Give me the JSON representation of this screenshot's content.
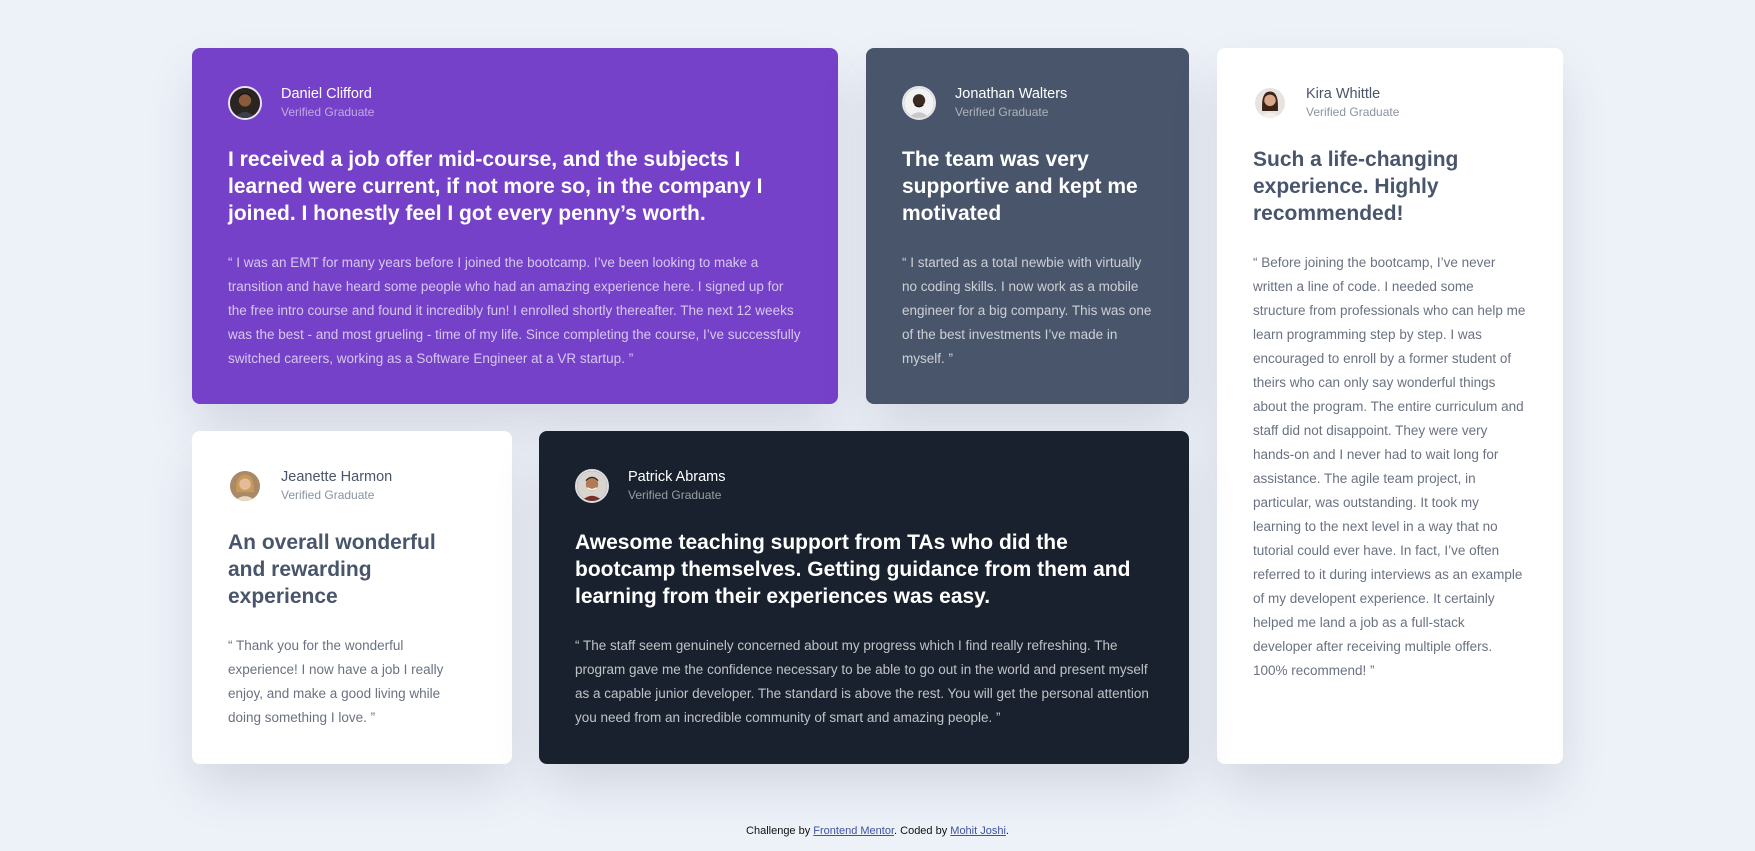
{
  "testimonials": [
    {
      "name": "Daniel Clifford",
      "role": "Verified Graduate",
      "avatar_icon": "avatar-daniel",
      "headline": "I received a job offer mid-course, and the subjects I learned were current, if not more so, in the company I joined. I honestly feel I got every penny’s worth.",
      "quote": "“ I was an EMT for many years before I joined the bootcamp. I’ve been looking to make a transition and have heard some people who had an amazing experience here. I signed up for the free intro course and found it incredibly fun! I enrolled shortly thereafter. The next 12 weeks was the best - and most grueling - time of my life. Since completing the course, I’ve successfully switched careers, working as a Software Engineer at a VR startup. ”"
    },
    {
      "name": "Jonathan Walters",
      "role": "Verified Graduate",
      "avatar_icon": "avatar-jonathan",
      "headline": "The team was very supportive and kept me motivated",
      "quote": "“ I started as a total newbie with virtually no coding skills. I now work as a mobile engineer for a big company. This was one of the best investments I’ve made in myself. ”"
    },
    {
      "name": "Kira Whittle",
      "role": "Verified Graduate",
      "avatar_icon": "avatar-kira",
      "headline": "Such a life-changing experience. Highly recommended!",
      "quote": "“ Before joining the bootcamp, I’ve never written a line of code. I needed some structure from professionals who can help me learn programming step by step. I was encouraged to enroll by a former student of theirs who can only say wonderful things about the program. The entire curriculum and staff did not disappoint. They were very hands-on and I never had to wait long for assistance. The agile team project, in particular, was outstanding. It took my learning to the next level in a way that no tutorial could ever have. In fact, I’ve often referred to it during interviews as an example of my developent experience. It certainly helped me land a job as a full-stack developer after receiving multiple offers. 100% recommend! ”"
    },
    {
      "name": "Jeanette Harmon",
      "role": "Verified Graduate",
      "avatar_icon": "avatar-jeanette",
      "headline": "An overall wonderful and rewarding experience",
      "quote": "“ Thank you for the wonderful experience! I now have a job I really enjoy, and make a good living while doing something I love. ”"
    },
    {
      "name": "Patrick Abrams",
      "role": "Verified Graduate",
      "avatar_icon": "avatar-patrick",
      "headline": "Awesome teaching support from TAs who did the bootcamp themselves. Getting guidance from them and learning from their experiences was easy.",
      "quote": "“ The staff seem genuinely concerned about my progress which I find really refreshing. The program gave me the confidence necessary to be able to go out in the world and present myself as a capable junior developer. The standard is above the rest. You will get the personal attention you need from an incredible community of smart and amazing people. ”"
    }
  ],
  "colors": {
    "background": "#edf1f8",
    "purple": "#7541c8",
    "grayish_blue": "#48556a",
    "dark_blackish_blue": "#19212e",
    "white": "#ffffff"
  },
  "attribution": {
    "prefix": "Challenge by ",
    "link1": "Frontend Mentor",
    "middle": ". Coded by ",
    "link2": "Mohit Joshi",
    "suffix": "."
  }
}
